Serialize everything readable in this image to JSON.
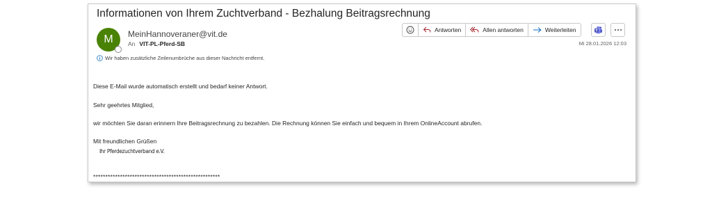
{
  "subject": "Informationen von Ihrem Zuchtverband - Bezhalung Beitragsrechnung",
  "sender": {
    "initial": "M",
    "email": "MeinHannoveraner@vit.de",
    "avatar_color": "#498205"
  },
  "recipient": {
    "prefix": "An",
    "name": "VIT-PL-Pferd-SB"
  },
  "info_notice": "Wir haben zusätzliche Zeilenumbrüche aus dieser Nachricht entfernt.",
  "toolbar": {
    "emoji_icon": "smiley-icon",
    "reply_label": "Antworten",
    "reply_all_label": "Allen antworten",
    "forward_label": "Weiterleiten",
    "teams_icon": "teams-icon",
    "more_icon": "more-icon"
  },
  "date": "Mi 28.01.2026 12:03",
  "body": {
    "line1": "Diese E-Mail wurde automatisch erstellt und bedarf keiner Antwort.",
    "greeting": "Sehr geehrtes Mitglied,",
    "message": "wir möchten Sie daran erinnern Ihre Beitragsrechnung zu bezahlen. Die Rechnung können Sie einfach und bequem in Ihrem OnlineAccount abrufen.",
    "closing": "Mit freundlichen Grüßen",
    "signature": "Ihr Pferdezuchtverband e.V.",
    "separator": "****************************************************"
  },
  "colors": {
    "accent": "#0f6cbd",
    "reply_all_icon": "#a4262c"
  }
}
